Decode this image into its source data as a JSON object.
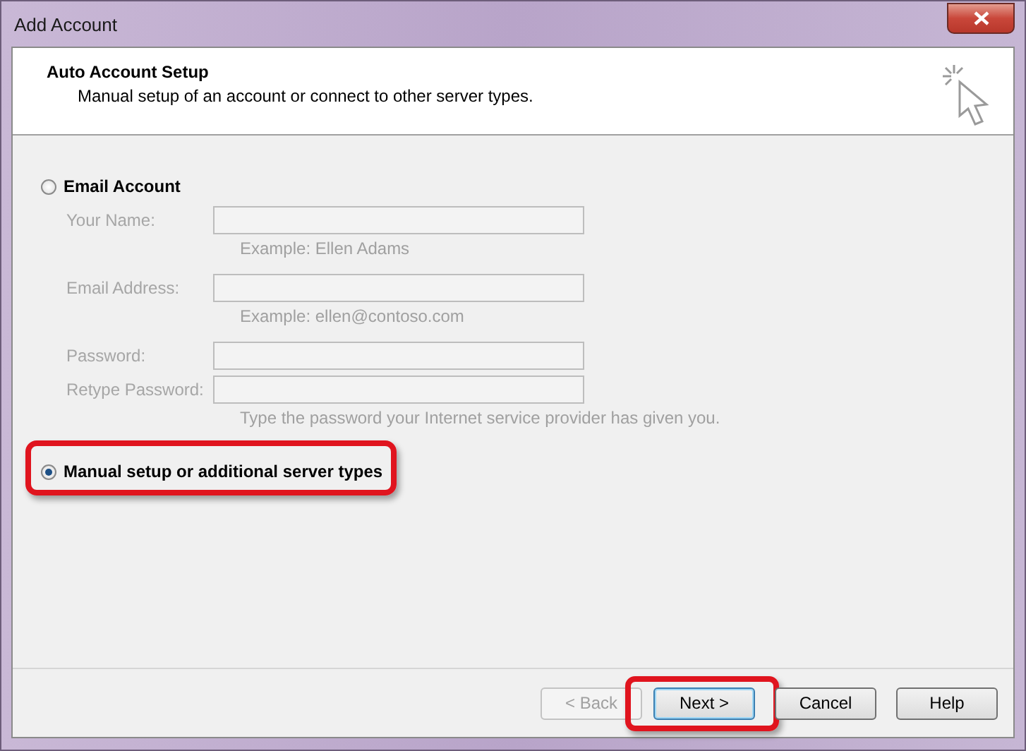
{
  "window": {
    "title": "Add Account"
  },
  "header": {
    "title": "Auto Account Setup",
    "subtitle": "Manual setup of an account or connect to other server types."
  },
  "options": [
    {
      "label": "Email Account",
      "selected": false,
      "highlighted": false,
      "fields": [
        {
          "label": "Your Name:",
          "disabled": true,
          "hint": "Example: Ellen Adams"
        },
        {
          "label": "Email Address:",
          "disabled": true,
          "hint": "Example: ellen@contoso.com"
        },
        {
          "label": "Password:",
          "disabled": true
        },
        {
          "label": "Retype Password:",
          "disabled": true,
          "hint": "Type the password your Internet service provider has given you."
        }
      ]
    },
    {
      "label": "Manual setup or additional server types",
      "selected": true,
      "highlighted": true
    }
  ],
  "buttons": [
    {
      "label": "< Back",
      "disabled": true,
      "default": false,
      "highlighted": false
    },
    {
      "label": "Next >",
      "disabled": false,
      "default": true,
      "highlighted": true
    },
    {
      "label": "Cancel",
      "disabled": false,
      "default": false,
      "highlighted": false
    },
    {
      "label": "Help",
      "disabled": false,
      "default": false,
      "highlighted": false
    }
  ]
}
